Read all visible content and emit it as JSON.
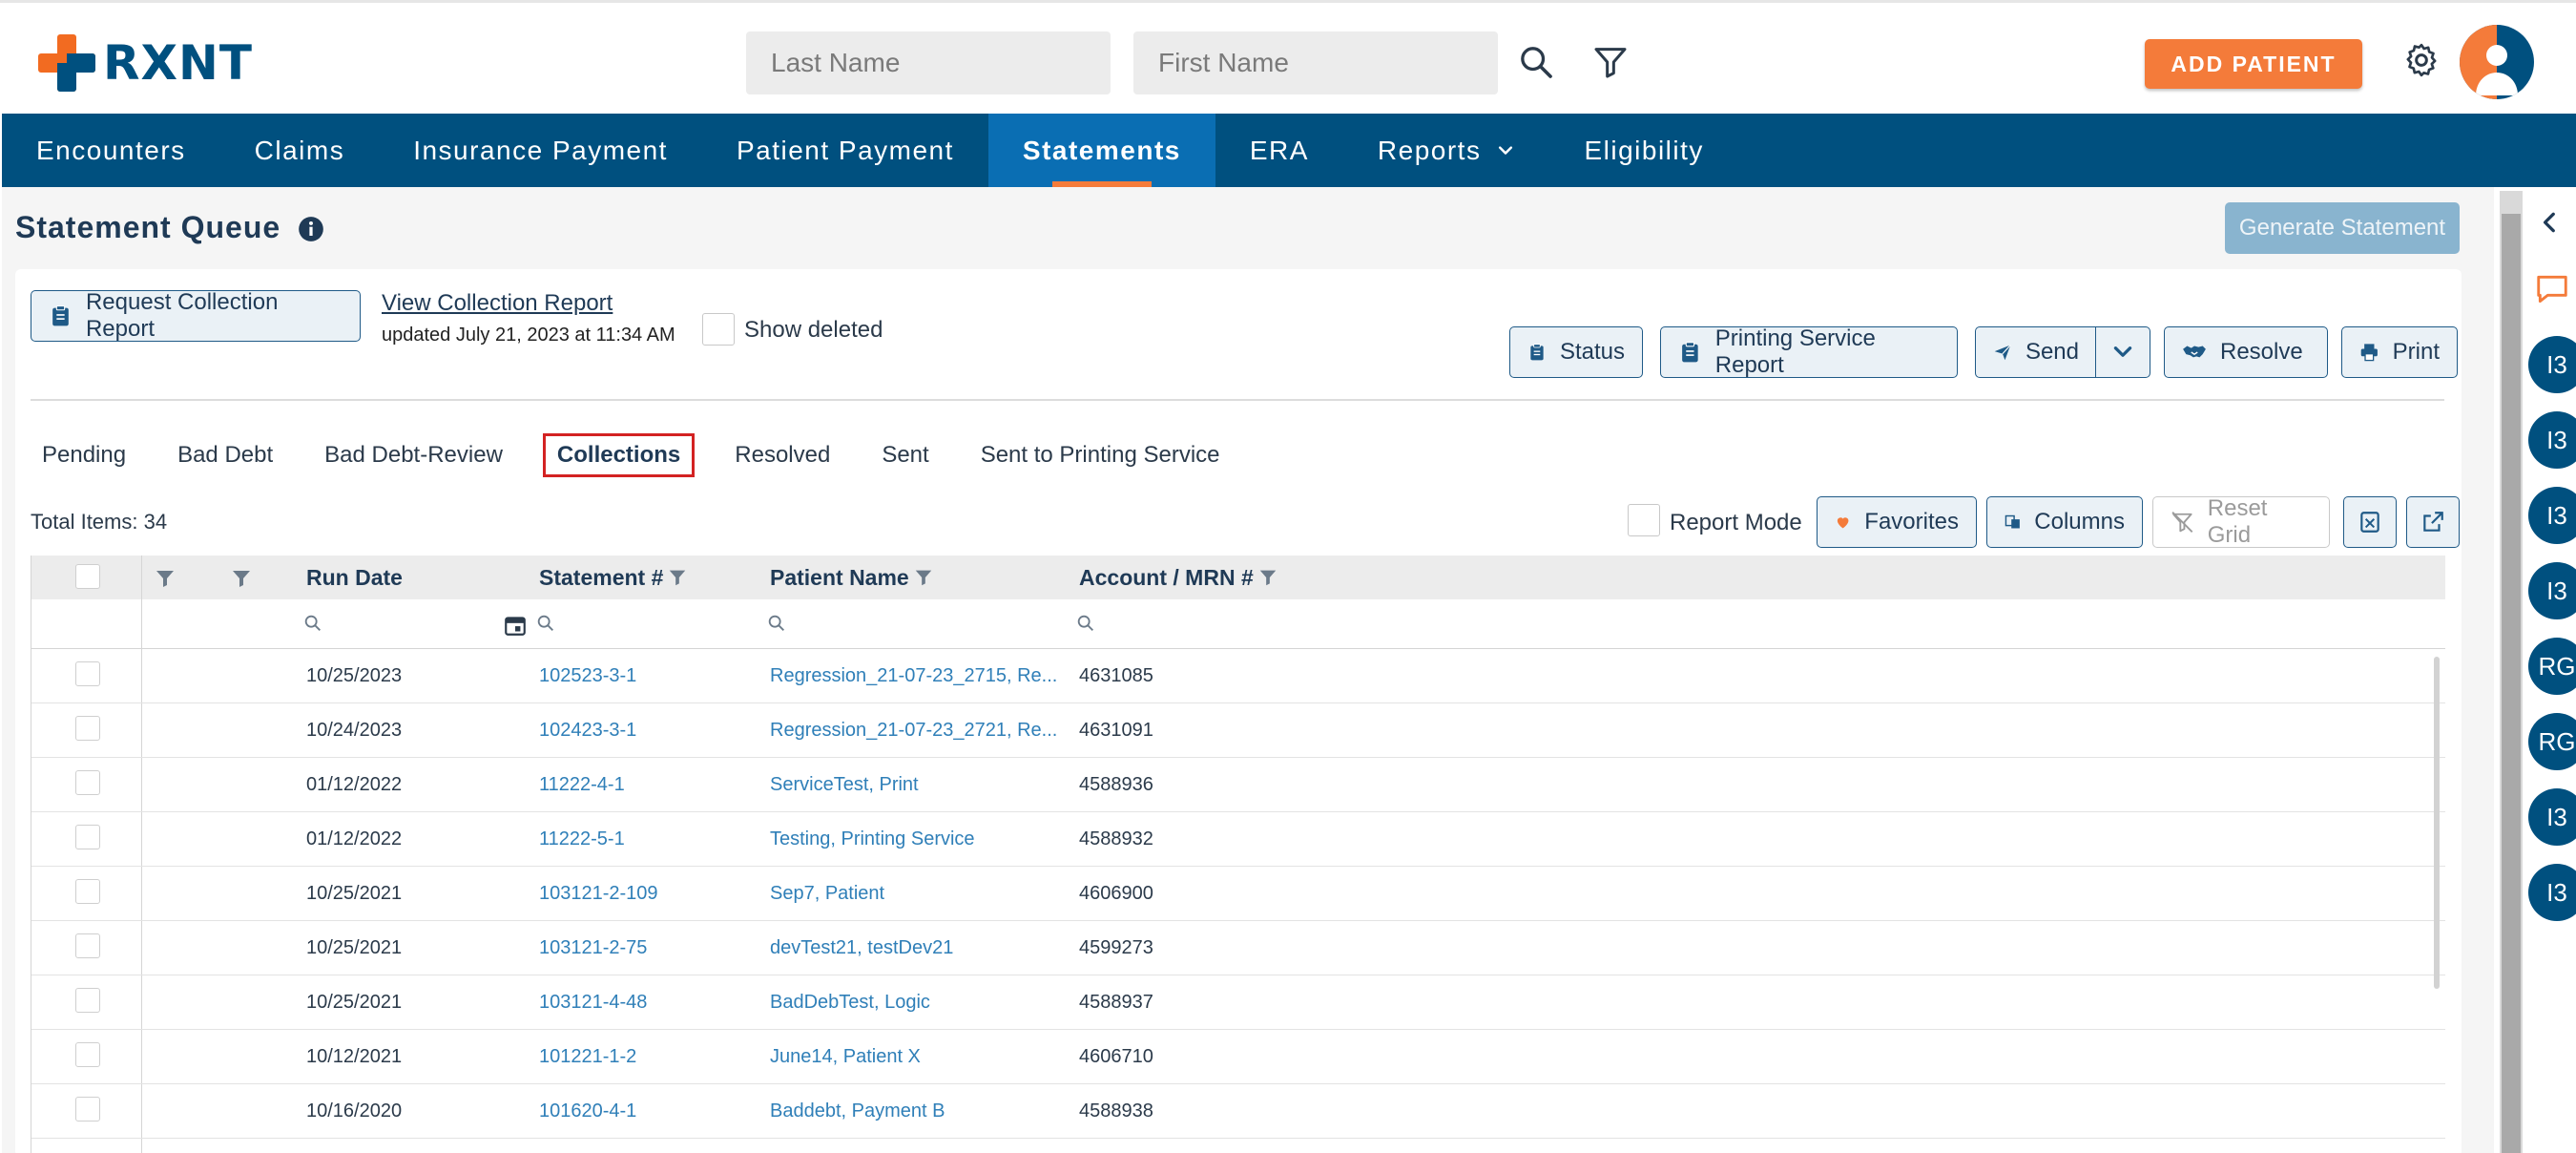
{
  "header": {
    "logo_text": "RXNT",
    "last_name_placeholder": "Last Name",
    "first_name_placeholder": "First Name",
    "add_patient_label": "ADD PATIENT"
  },
  "nav": {
    "items": [
      "Encounters",
      "Claims",
      "Insurance Payment",
      "Patient Payment",
      "Statements",
      "ERA",
      "Reports",
      "Eligibility"
    ],
    "active": "Statements"
  },
  "page": {
    "title": "Statement Queue",
    "generate_statement_label": "Generate Statement"
  },
  "toolbar": {
    "request_collection_label": "Request Collection Report",
    "view_collection_link": "View Collection Report",
    "updated_text": "updated July 21, 2023 at 11:34 AM",
    "show_deleted_label": "Show deleted",
    "status_label": "Status",
    "printing_report_label": "Printing Service Report",
    "send_label": "Send",
    "resolve_label": "Resolve",
    "print_label": "Print"
  },
  "tabs": {
    "items": [
      "Pending",
      "Bad Debt",
      "Bad Debt-Review",
      "Collections",
      "Resolved",
      "Sent",
      "Sent to Printing Service"
    ],
    "active": "Collections"
  },
  "grid_controls": {
    "total_items": "Total Items: 34",
    "report_mode_label": "Report Mode",
    "favorites_label": "Favorites",
    "columns_label": "Columns",
    "reset_grid_label": "Reset Grid"
  },
  "grid": {
    "columns": [
      "Run Date",
      "Statement #",
      "Patient Name",
      "Account / MRN #"
    ],
    "rows": [
      {
        "run_date": "10/25/2023",
        "statement": "102523-3-1",
        "patient": "Regression_21-07-23_2715, Re...",
        "account": "4631085"
      },
      {
        "run_date": "10/24/2023",
        "statement": "102423-3-1",
        "patient": "Regression_21-07-23_2721, Re...",
        "account": "4631091"
      },
      {
        "run_date": "01/12/2022",
        "statement": "11222-4-1",
        "patient": "ServiceTest, Print",
        "account": "4588936"
      },
      {
        "run_date": "01/12/2022",
        "statement": "11222-5-1",
        "patient": "Testing, Printing Service",
        "account": "4588932"
      },
      {
        "run_date": "10/25/2021",
        "statement": "103121-2-109",
        "patient": "Sep7, Patient",
        "account": "4606900"
      },
      {
        "run_date": "10/25/2021",
        "statement": "103121-2-75",
        "patient": "devTest21, testDev21",
        "account": "4599273"
      },
      {
        "run_date": "10/25/2021",
        "statement": "103121-4-48",
        "patient": "BadDebTest, Logic",
        "account": "4588937"
      },
      {
        "run_date": "10/12/2021",
        "statement": "101221-1-2",
        "patient": "June14, Patient X",
        "account": "4606710"
      },
      {
        "run_date": "10/16/2020",
        "statement": "101620-4-1",
        "patient": "Baddebt, Payment B",
        "account": "4588938"
      }
    ]
  },
  "rail": {
    "avatars": [
      "I3",
      "I3",
      "I3",
      "I3",
      "RG",
      "RG",
      "I3",
      "I3"
    ]
  },
  "colors": {
    "brand_blue": "#00507f",
    "nav_active": "#0a6eb3",
    "accent_orange": "#f47b3a",
    "link_blue": "#2f7fb8",
    "active_tab_border": "#d32222"
  }
}
